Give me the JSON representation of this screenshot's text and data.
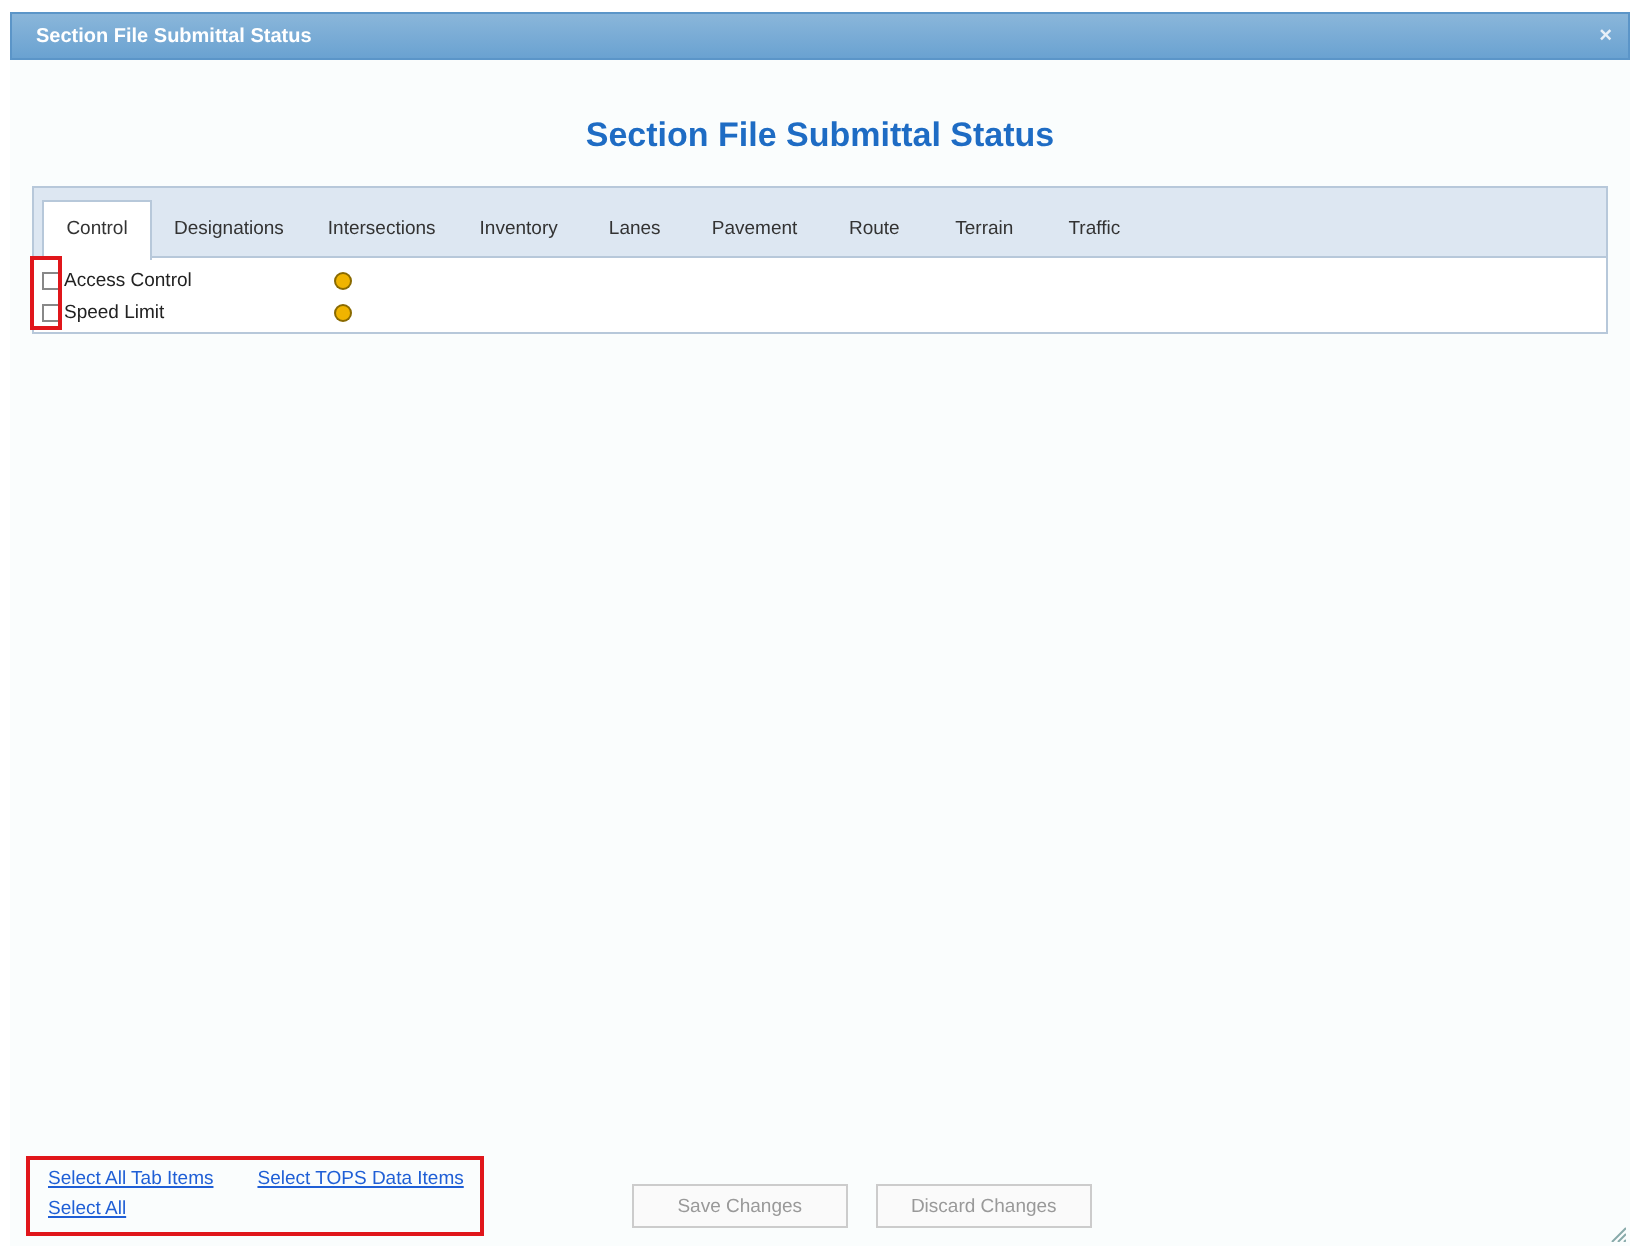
{
  "window": {
    "title": "Section File Submittal Status",
    "close": "×"
  },
  "heading": "Section File Submittal Status",
  "tabs": [
    {
      "label": "Control",
      "selected": true
    },
    {
      "label": "Designations",
      "selected": false
    },
    {
      "label": "Intersections",
      "selected": false
    },
    {
      "label": "Inventory",
      "selected": false
    },
    {
      "label": "Lanes",
      "selected": false
    },
    {
      "label": "Pavement",
      "selected": false
    },
    {
      "label": "Route",
      "selected": false
    },
    {
      "label": "Terrain",
      "selected": false
    },
    {
      "label": "Traffic",
      "selected": false
    }
  ],
  "items": [
    {
      "label": "Access Control",
      "checked": false,
      "color": "#f0b400"
    },
    {
      "label": "Speed Limit",
      "checked": false,
      "color": "#f0b400"
    }
  ],
  "links": [
    "Select All Tab Items",
    "Select TOPS Data Items",
    "Select All"
  ],
  "buttons": [
    {
      "label": "Save Changes",
      "disabled": true
    },
    {
      "label": "Discard Changes",
      "disabled": true
    }
  ]
}
